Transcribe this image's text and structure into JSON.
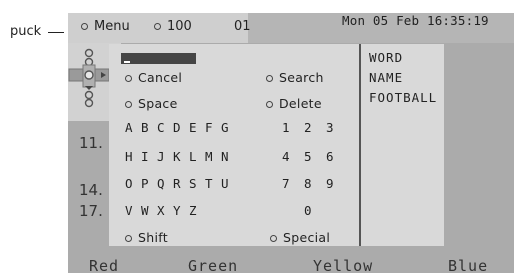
{
  "annotation": {
    "label": "puck"
  },
  "topbar": {
    "menu_label": "Menu",
    "channel_number": "100",
    "sub_number": "01",
    "datetime": "Mon 05 Feb 16:35:19"
  },
  "channels": [
    "11.",
    "14.",
    "17."
  ],
  "search": {
    "input_value": "_"
  },
  "keyboard": {
    "cancel_label": "Cancel",
    "search_label": "Search",
    "space_label": "Space",
    "delete_label": "Delete",
    "shift_label": "Shift",
    "special_label": "Special",
    "letter_rows": [
      [
        "A",
        "B",
        "C",
        "D",
        "E",
        "F",
        "G"
      ],
      [
        "H",
        "I",
        "J",
        "K",
        "L",
        "M",
        "N"
      ],
      [
        "O",
        "P",
        "Q",
        "R",
        "S",
        "T",
        "U"
      ],
      [
        "V",
        "W",
        "X",
        "Y",
        "Z"
      ]
    ],
    "number_rows": [
      [
        "1",
        "2",
        "3"
      ],
      [
        "4",
        "5",
        "6"
      ],
      [
        "7",
        "8",
        "9"
      ],
      [
        "",
        "0",
        ""
      ]
    ]
  },
  "results": [
    "WORD",
    "NAME",
    "FOOTBALL"
  ],
  "color_buttons": {
    "red": "Red",
    "green": "Green",
    "yellow": "Yellow",
    "blue": "Blue"
  },
  "colors": {
    "screen_bg": "#ababab",
    "panel_bg": "#d9d9d9",
    "text": "#222222"
  }
}
